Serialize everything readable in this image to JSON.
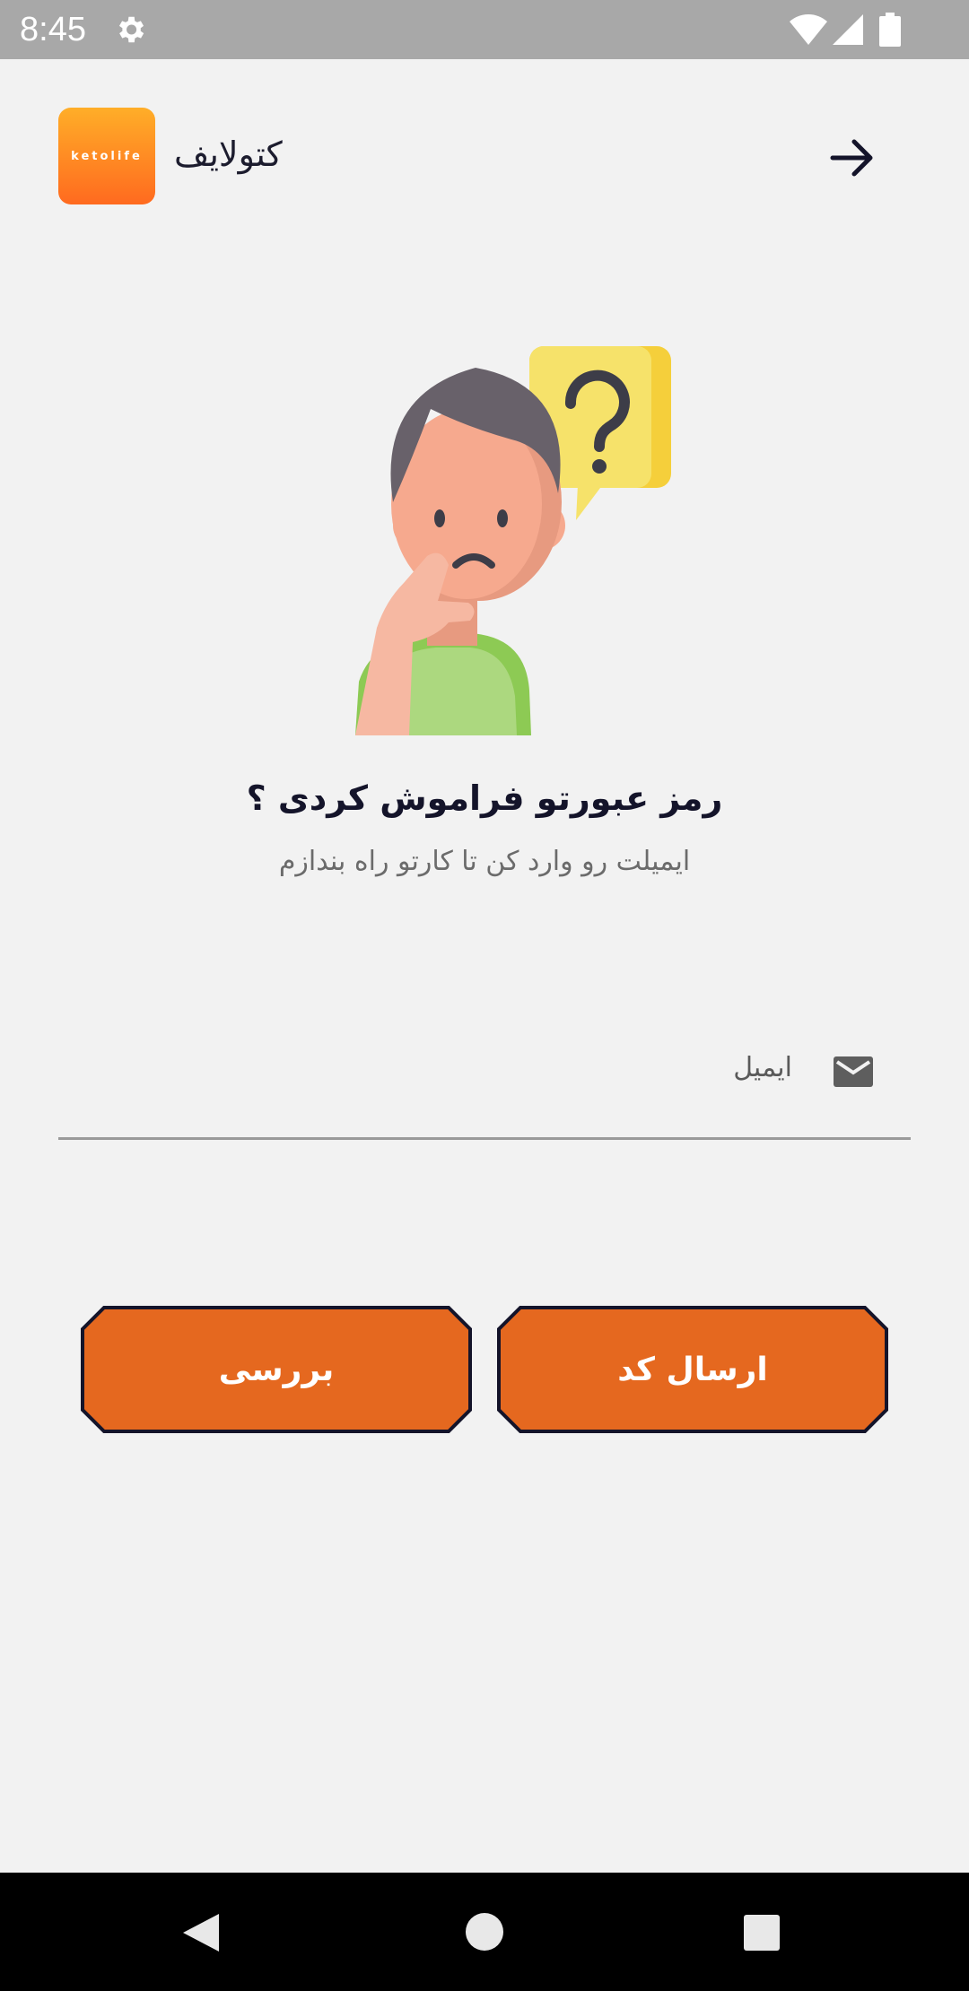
{
  "status_bar": {
    "time": "8:45",
    "icons": [
      "gear-icon",
      "wifi-icon",
      "signal-icon",
      "battery-icon"
    ]
  },
  "app_bar": {
    "logo_text": "ketolife",
    "title": "کتولایف",
    "back_icon": "arrow-right-icon"
  },
  "illustration": {
    "icon": "thinking-person-question-icon"
  },
  "main": {
    "headline": "رمز عبورتو فراموش کردی ؟",
    "subtitle": "ایمیلت رو وارد کن تا کارتو راه بندازم"
  },
  "email_field": {
    "label": "ایمیل",
    "icon": "mail-icon",
    "value": ""
  },
  "buttons": {
    "send_code": "ارسال کد",
    "check": "بررسی"
  },
  "nav_bar": {
    "icons": [
      "back-triangle-icon",
      "home-circle-icon",
      "recents-square-icon"
    ]
  },
  "colors": {
    "status_bar": "#a8a8a8",
    "background": "#f2f2f2",
    "accent": "#e5681f",
    "button_border": "#14142a",
    "logo_gradient_top": "#ffae28",
    "logo_gradient_bottom": "#ff6a1f"
  }
}
